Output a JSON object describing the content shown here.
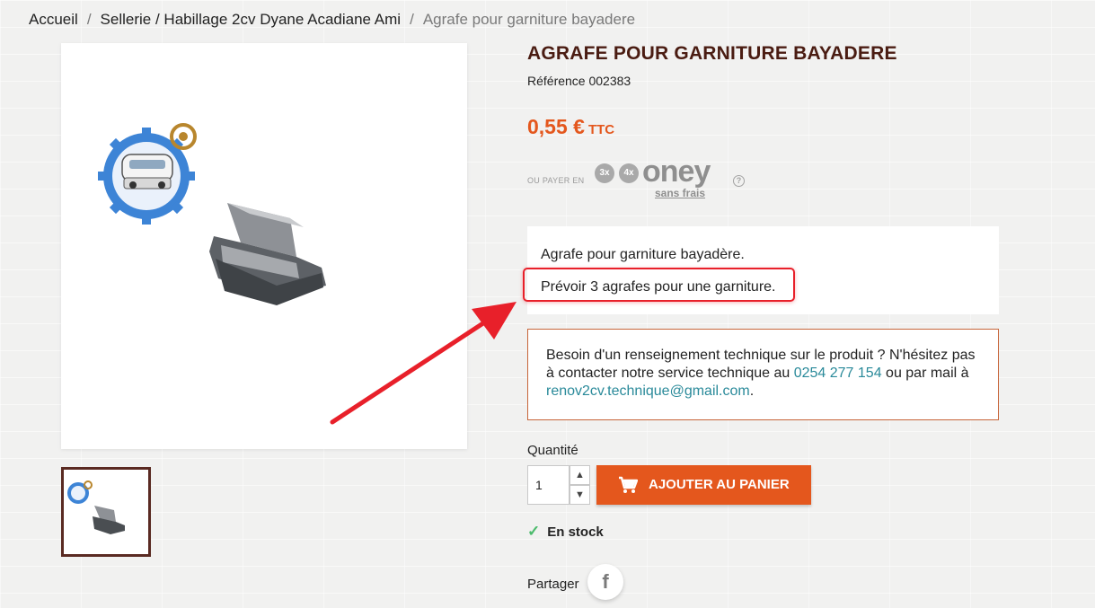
{
  "breadcrumb": {
    "items": [
      "Accueil",
      "Sellerie / Habillage 2cv Dyane Acadiane Ami"
    ],
    "current": "Agrafe pour garniture bayadere",
    "separator": "/"
  },
  "product": {
    "title": "AGRAFE POUR GARNITURE BAYADERE",
    "reference": "Référence 002383",
    "price": "0,55 €",
    "price_suffix": "TTC"
  },
  "oney": {
    "prefix": "OU PAYER EN",
    "badges": [
      "3x",
      "4x"
    ],
    "logo": "oney",
    "sub": "sans frais",
    "help": "?"
  },
  "description": {
    "line1": "Agrafe pour garniture bayadère.",
    "line2": "Prévoir 3 agrafes pour une garniture."
  },
  "support": {
    "text1": "Besoin d'un renseignement technique sur le produit ? N'hésitez pas à contacter notre service technique au ",
    "phone": "0254 277 154",
    "text2": " ou par mail à ",
    "email": "renov2cv.technique@gmail.com",
    "text3": "."
  },
  "quantity": {
    "label": "Quantité",
    "value": "1",
    "up": "▲",
    "down": "▼"
  },
  "add_to_cart": "AJOUTER AU PANIER",
  "stock": {
    "check": "✓",
    "label": "En stock"
  },
  "share": {
    "label": "Partager",
    "facebook": "f"
  },
  "colors": {
    "accent": "#e4571d",
    "title": "#4a1c12",
    "highlight": "#e8202a",
    "link": "#2a8a9a",
    "stock": "#4cbb6c"
  }
}
